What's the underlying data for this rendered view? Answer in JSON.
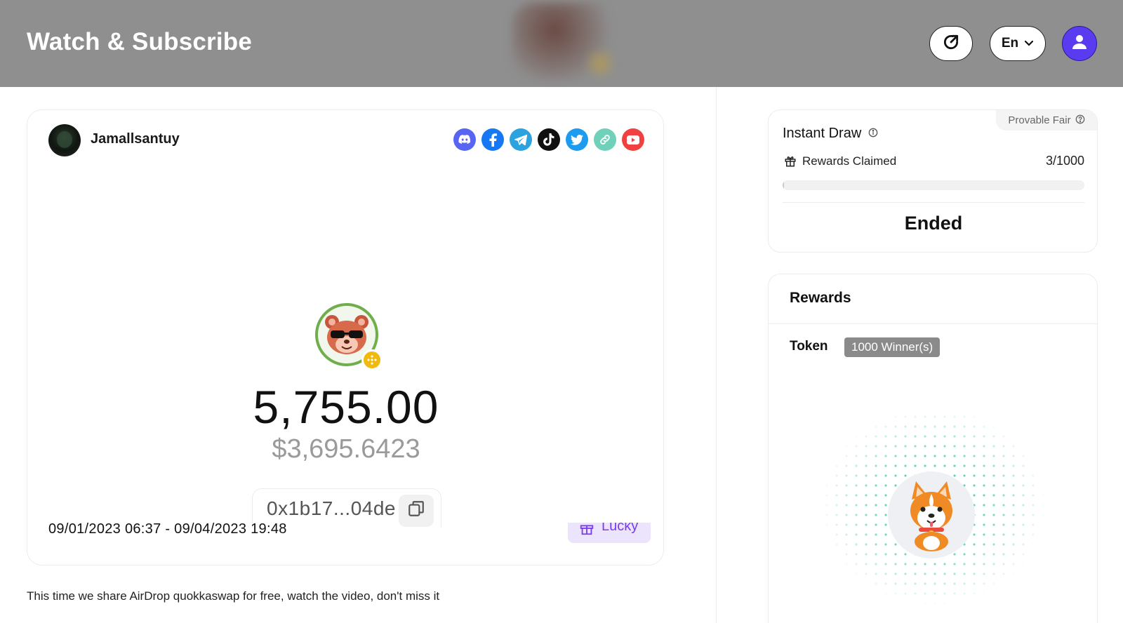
{
  "header": {
    "brand": "Watch & Subscribe",
    "lang": "En"
  },
  "creator": {
    "username": "Jamallsantuy"
  },
  "socials": [
    {
      "name": "discord",
      "color": "#5865f2"
    },
    {
      "name": "facebook",
      "color": "#1877f2"
    },
    {
      "name": "telegram",
      "color": "#2aa3df"
    },
    {
      "name": "tiktok",
      "color": "#111111"
    },
    {
      "name": "twitter",
      "color": "#1d9bf0"
    },
    {
      "name": "link",
      "color": "#6fd1b9"
    },
    {
      "name": "youtube",
      "color": "#f04040"
    }
  ],
  "airdrop": {
    "amount": "5,755.00",
    "usd_value": "$3,695.6423",
    "address": "0x1b17...04de",
    "date_range": "09/01/2023 06:37 - 09/04/2023 19:48",
    "type_label": "Lucky"
  },
  "description": "This time we share AirDrop quokkaswap for free, watch the video, don't miss it",
  "instant_draw": {
    "title": "Instant Draw",
    "provable_fair": "Provable Fair",
    "rewards_claimed_label": "Rewards Claimed",
    "rewards_claimed_count": "3/1000",
    "progress_fraction": 0.003,
    "status": "Ended"
  },
  "rewards": {
    "title": "Rewards",
    "token_label": "Token",
    "winners_badge": "1000 Winner(s)"
  },
  "colors": {
    "header_bg": "#8f8f8f",
    "accent_purple": "#5b3bf0",
    "lucky_text": "#7a3cf0",
    "dots": "#37c9a0"
  }
}
